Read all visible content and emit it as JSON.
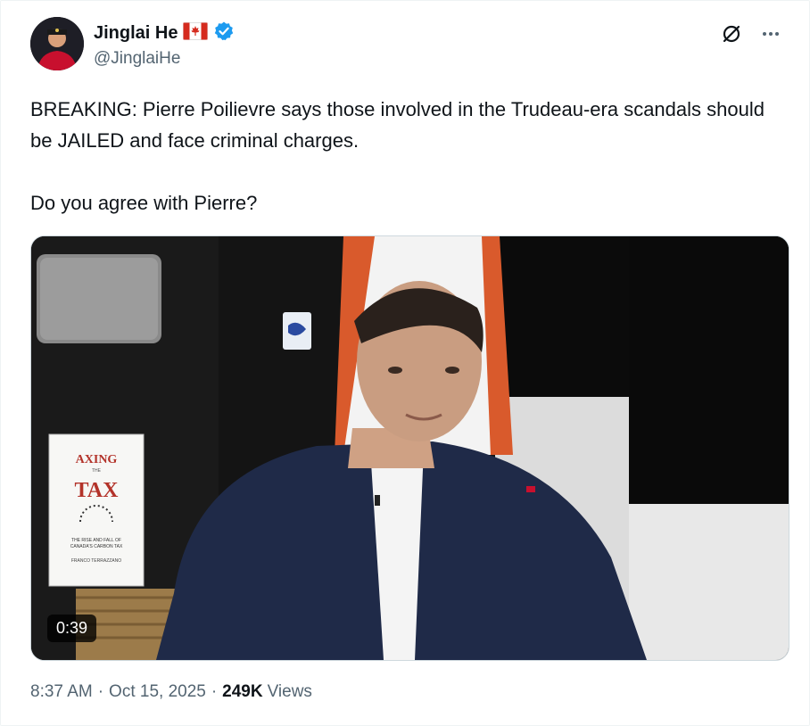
{
  "author": {
    "name": "Jinglai He",
    "flag": "🇨🇦",
    "handle": "@JinglaiHe",
    "verified": true
  },
  "header": {
    "grok_icon": "slashed-circle-icon",
    "more_icon": "more-horizontal-icon"
  },
  "tweet": {
    "line1": "BREAKING: Pierre Poilievre says those involved in the Trudeau-era scandals should be JAILED and face criminal charges.",
    "line2": "Do you agree with Pierre?"
  },
  "media": {
    "duration": "0:39",
    "book_title_top": "AXING",
    "book_title_mid": "THE",
    "book_title_main": "TAX",
    "book_subtitle1": "THE RISE AND FALL OF",
    "book_subtitle2": "CANADA'S CARBON TAX",
    "book_author": "FRANCO TERRAZZANO"
  },
  "meta": {
    "time": "8:37 AM",
    "date": "Oct 15, 2025",
    "views_count": "249K",
    "views_label": "Views"
  },
  "colors": {
    "verified_blue": "#1d9bf0",
    "text_primary": "#0f1419",
    "text_secondary": "#536471"
  }
}
